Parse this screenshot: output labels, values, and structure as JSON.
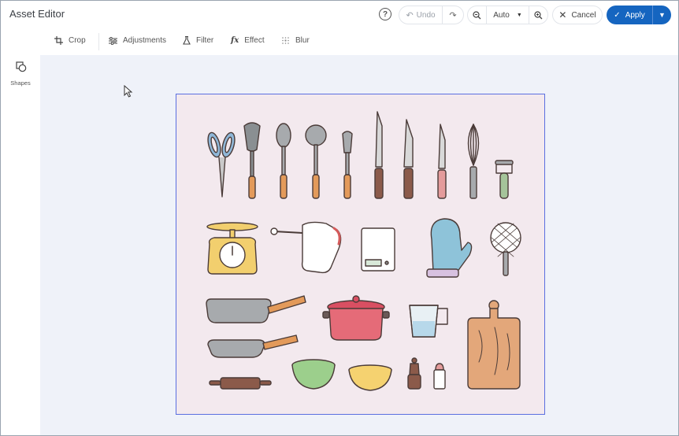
{
  "header": {
    "title": "Asset Editor",
    "help_glyph": "?",
    "undo_label": "Undo",
    "zoom_value": "Auto",
    "cancel_label": "Cancel",
    "apply_label": "Apply"
  },
  "toolbar": {
    "items": [
      {
        "label": "Crop",
        "icon": "crop-icon"
      },
      {
        "label": "Adjustments",
        "icon": "sliders-icon"
      },
      {
        "label": "Filter",
        "icon": "flask-icon"
      },
      {
        "label": "Effect",
        "icon": "fx-icon"
      },
      {
        "label": "Blur",
        "icon": "blur-icon"
      }
    ]
  },
  "sidebar": {
    "shapes_label": "Shapes"
  },
  "colors": {
    "primary": "#1565c0",
    "canvas_bg": "#f3e9ee",
    "selection": "#5a6fe0",
    "workspace_bg": "#eff2f9"
  }
}
